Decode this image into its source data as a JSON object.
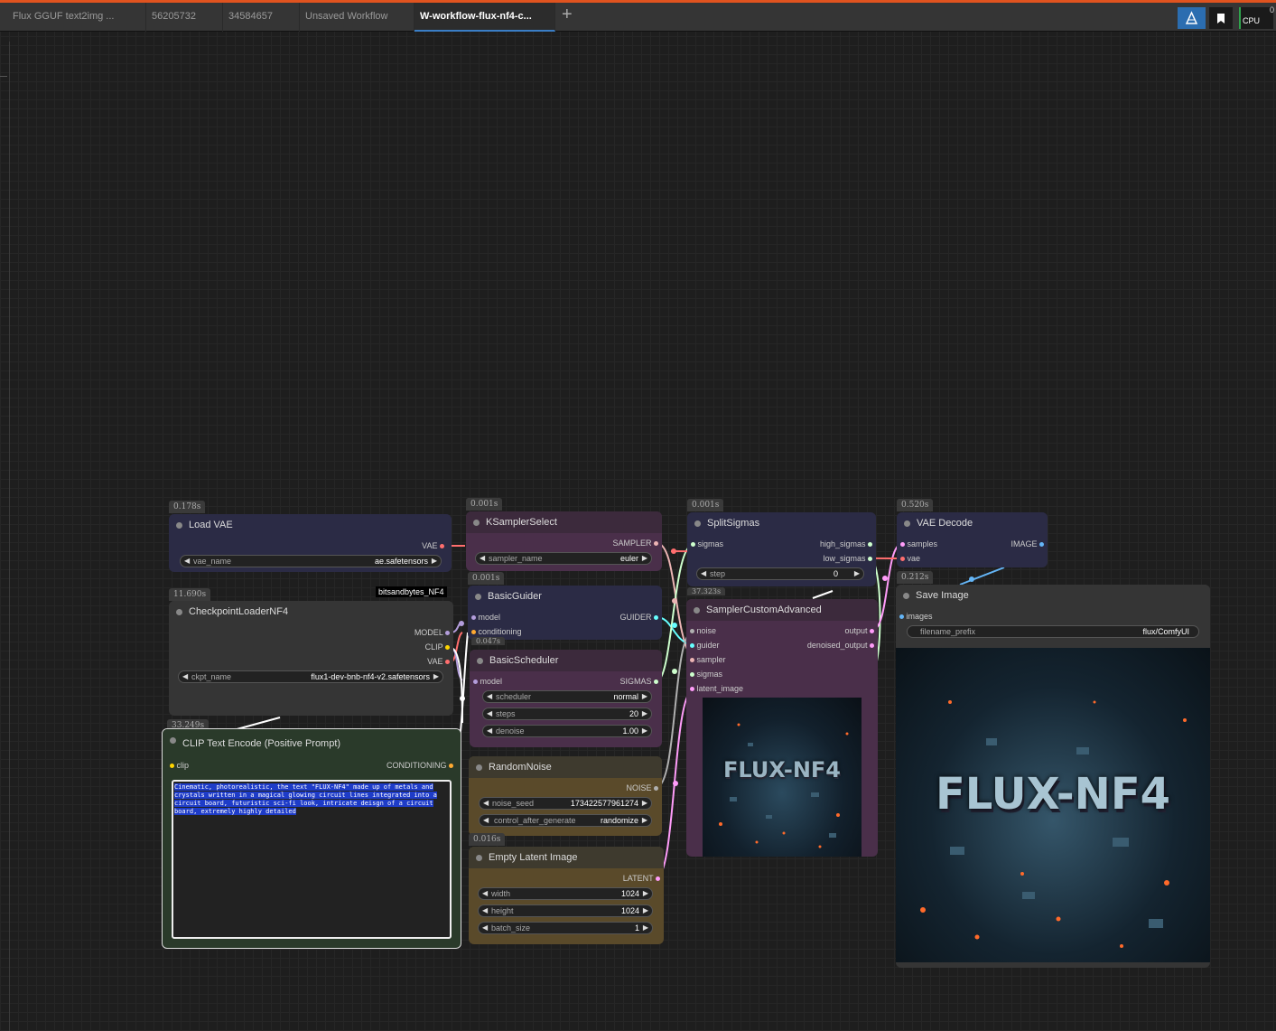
{
  "tabs": [
    {
      "label": "Flux GGUF text2img ..."
    },
    {
      "label": "56205732"
    },
    {
      "label": "34584657"
    },
    {
      "label": "Unsaved Workflow"
    },
    {
      "label": "W-workflow-flux-nf4-c..."
    }
  ],
  "toolbar": {
    "add_tab": "+",
    "cpu_label": "CPU",
    "cpu_percent": "0"
  },
  "nodes": {
    "load_vae": {
      "time": "0.178s",
      "title": "Load VAE",
      "out_vae": "VAE",
      "vae_name_label": "vae_name",
      "vae_name_value": "ae.safetensors"
    },
    "checkpoint": {
      "time": "11.690s",
      "tag": "bitsandbytes_NF4",
      "title": "CheckpointLoaderNF4",
      "out_model": "MODEL",
      "out_clip": "CLIP",
      "out_vae": "VAE",
      "ckpt_label": "ckpt_name",
      "ckpt_value": "flux1-dev-bnb-nf4-v2.safetensors"
    },
    "clip_encode": {
      "time": "33.249s",
      "title": "CLIP Text Encode (Positive Prompt)",
      "in_clip": "clip",
      "out_cond": "CONDITIONING",
      "prompt": "Cinematic, photorealistic, the text \"FLUX-NF4\" made up of metals and crystals written in a magical glowing circuit lines integrated into a circuit board, futuristic sci-fi look, intricate deisgn of a circuit board, extremely highly detailed"
    },
    "ksampler_select": {
      "time": "0.001s",
      "title": "KSamplerSelect",
      "out_sampler": "SAMPLER",
      "sampler_label": "sampler_name",
      "sampler_value": "euler"
    },
    "basic_guider": {
      "time": "0.001s",
      "title": "BasicGuider",
      "in_model": "model",
      "in_cond": "conditioning",
      "out_guider": "GUIDER"
    },
    "basic_scheduler": {
      "time": "0.047s",
      "title": "BasicScheduler",
      "in_model": "model",
      "out_sigmas": "SIGMAS",
      "scheduler_label": "scheduler",
      "scheduler_value": "normal",
      "steps_label": "steps",
      "steps_value": "20",
      "denoise_label": "denoise",
      "denoise_value": "1.00"
    },
    "random_noise": {
      "title": "RandomNoise",
      "out_noise": "NOISE",
      "seed_label": "noise_seed",
      "seed_value": "173422577961274",
      "control_label": "control_after_generate",
      "control_value": "randomize"
    },
    "empty_latent": {
      "time": "0.016s",
      "title": "Empty Latent Image",
      "out_latent": "LATENT",
      "width_label": "width",
      "width_value": "1024",
      "height_label": "height",
      "height_value": "1024",
      "batch_label": "batch_size",
      "batch_value": "1"
    },
    "split_sigmas": {
      "time": "0.001s",
      "title": "SplitSigmas",
      "in_sigmas": "sigmas",
      "out_high": "high_sigmas",
      "out_low": "low_sigmas",
      "step_label": "step",
      "step_value": "0"
    },
    "sampler_custom": {
      "time": "37.323s",
      "title": "SamplerCustomAdvanced",
      "in_noise": "noise",
      "in_guider": "guider",
      "in_sampler": "sampler",
      "in_sigmas": "sigmas",
      "in_latent": "latent_image",
      "out_output": "output",
      "out_denoised": "denoised_output",
      "preview_text": "FLUX-NF4"
    },
    "vae_decode": {
      "time": "0.520s",
      "title": "VAE Decode",
      "in_samples": "samples",
      "in_vae": "vae",
      "out_image": "IMAGE"
    },
    "save_image": {
      "time": "0.212s",
      "title": "Save Image",
      "in_images": "images",
      "prefix_label": "filename_prefix",
      "prefix_value": "flux/ComfyUI",
      "preview_text": "FLUX-NF4"
    }
  },
  "colors": {
    "vae": "#ff6e6e",
    "model": "#b39ddb",
    "clip": "#ffd500",
    "conditioning": "#ffa931",
    "sampler": "#ecb4b4",
    "guider": "#66ffff",
    "sigmas": "#cdffcd",
    "noise": "#b0b0b0",
    "latent": "#ff9cf9",
    "image": "#64b5f6"
  }
}
